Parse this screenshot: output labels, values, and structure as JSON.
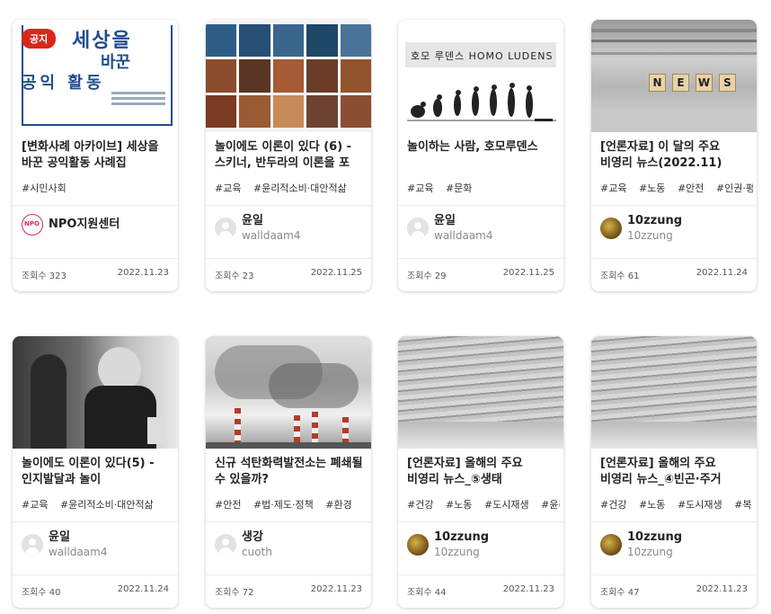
{
  "cards": [
    {
      "badge": "공지",
      "thumb_text": [
        "세상을",
        "바꾼",
        "공익 활동"
      ],
      "title": "[변화사례 아카이브] 세상을 바꾼 공익활동 사례집",
      "tags": [
        "#시민사회"
      ],
      "author_name": "NPO지원센터",
      "author_id": "",
      "avatar_label": "NPO",
      "views": "조회수 323",
      "date": "2022.11.23"
    },
    {
      "title": "놀이에도 이론이 있다 (6) - 스키너, 반두라의 이론을 포",
      "tags": [
        "#교육",
        "#윤리적소비·대안적삶"
      ],
      "author_name": "윤일",
      "author_id": "walldaam4",
      "views": "조회수 23",
      "date": "2022.11.25"
    },
    {
      "thumb_text": [
        "호모 루덴스 HOMO LUDENS"
      ],
      "title": "놀이하는 사람, 호모루덴스",
      "tags": [
        "#교육",
        "#문화"
      ],
      "author_name": "윤일",
      "author_id": "walldaam4",
      "views": "조회수 29",
      "date": "2022.11.25"
    },
    {
      "thumb_text": [
        "N",
        "E",
        "W",
        "S"
      ],
      "title": "[언론자료] 이 달의 주요 비영리 뉴스(2022.11)",
      "tags": [
        "#교육",
        "#노동",
        "#안전",
        "#인권·평"
      ],
      "author_name": "10zzung",
      "author_id": "10zzung",
      "views": "조회수 61",
      "date": "2022.11.24"
    },
    {
      "title": "놀이에도 이론이 있다(5) - 인지발달과 놀이",
      "tags": [
        "#교육",
        "#윤리적소비·대안적삶"
      ],
      "author_name": "윤일",
      "author_id": "walldaam4",
      "views": "조회수 40",
      "date": "2022.11.24"
    },
    {
      "title": "신규 석탄화력발전소는 폐쇄될 수 있을까?",
      "tags": [
        "#안전",
        "#법·제도·정책",
        "#환경"
      ],
      "author_name": "생강",
      "author_id": "cuoth",
      "views": "조회수 72",
      "date": "2022.11.23"
    },
    {
      "title": "[언론자료] 올해의 주요 비영리 뉴스_⑤생태",
      "tags": [
        "#건강",
        "#노동",
        "#도시재생",
        "#윤리"
      ],
      "author_name": "10zzung",
      "author_id": "10zzung",
      "views": "조회수 44",
      "date": "2022.11.23"
    },
    {
      "title": "[언론자료] 올해의 주요 비영리 뉴스_④빈곤·주거",
      "tags": [
        "#건강",
        "#노동",
        "#도시재생",
        "#복"
      ],
      "author_name": "10zzung",
      "author_id": "10zzung",
      "views": "조회수 47",
      "date": "2022.11.23"
    }
  ]
}
